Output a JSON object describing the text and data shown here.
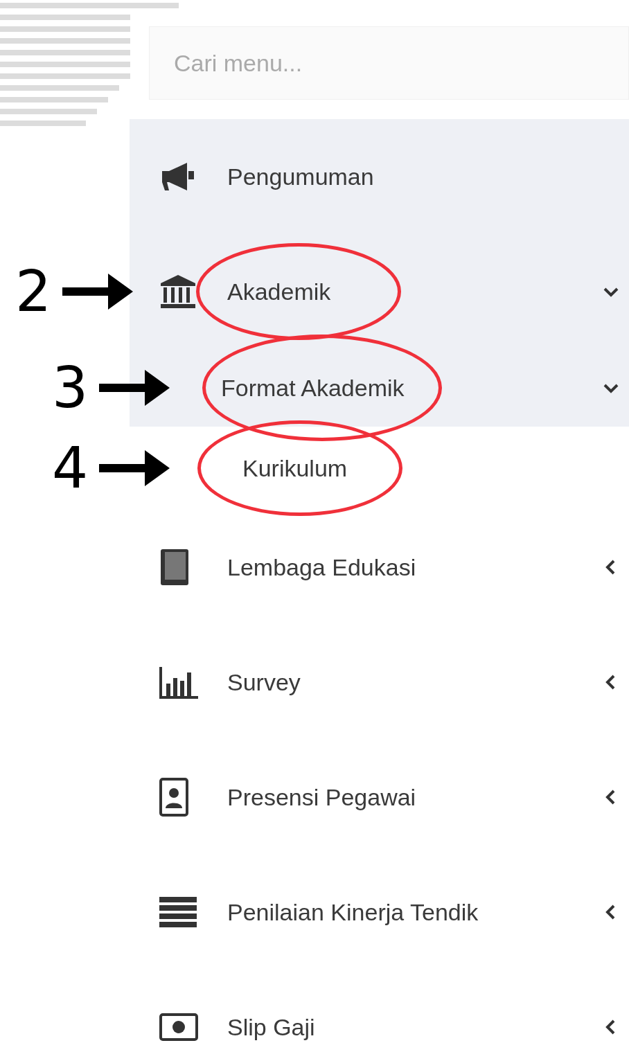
{
  "search": {
    "placeholder": "Cari menu..."
  },
  "menu": [
    {
      "label": "Pengumuman",
      "highlighted": true
    },
    {
      "label": "Akademik",
      "highlighted": true,
      "expanded": true,
      "annotation": "2",
      "children": [
        {
          "label": "Format Akademik",
          "highlighted": true,
          "expanded": true,
          "annotation": "3",
          "children": [
            {
              "label": "Kurikulum",
              "highlighted": false,
              "annotation": "4"
            }
          ]
        }
      ]
    },
    {
      "label": "Lembaga Edukasi",
      "highlighted": false,
      "expanded": false
    },
    {
      "label": "Survey",
      "highlighted": false,
      "expanded": false
    },
    {
      "label": "Presensi Pegawai",
      "highlighted": false,
      "expanded": false
    },
    {
      "label": "Penilaian Kinerja Tendik",
      "highlighted": false,
      "expanded": false
    },
    {
      "label": "Slip Gaji",
      "highlighted": false,
      "expanded": false
    }
  ]
}
